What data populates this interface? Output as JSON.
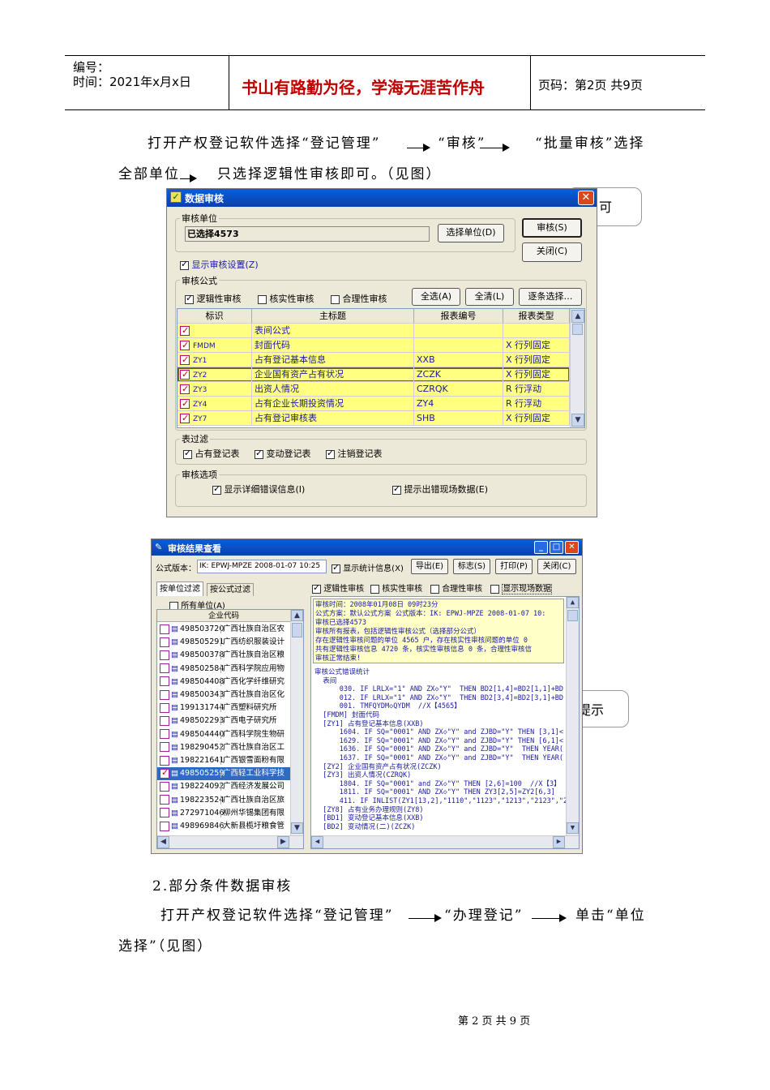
{
  "header": {
    "number_label": "编号：",
    "date_label": "时间：2021年x月x日",
    "motto": "书山有路勤为径，学海无涯苦作舟",
    "page_label": "页码：第2页  共9页"
  },
  "body": {
    "p1_a": "打开产权登记软件选择“登记管理”",
    "p1_b": "“审核”",
    "p1_c": "“批量审核”选择",
    "p1_d": "全部单位",
    "p1_e": "只选择逻辑性审核即可。（见图）",
    "callout1": "可",
    "callout2": "提示",
    "section2": "2.部分条件数据审核",
    "p2_a": "打开产权登记软件选择“登记管理”",
    "p2_b": "“办理登记”",
    "p2_c": "单击“单位",
    "p2_d": "选择”（见图）"
  },
  "dialog1": {
    "title": "数据审核",
    "unit_group": "审核单位",
    "unit_value": "已选择4573",
    "select_unit_btn": "选择单位(D)",
    "audit_btn": "审核(S)",
    "close_btn": "关闭(C)",
    "show_settings": "显示审核设置(Z)",
    "formula_group": "审核公式",
    "chk_logic": "逻辑性审核",
    "chk_real": "核实性审核",
    "chk_reason": "合理性审核",
    "btn_all": "全选(A)",
    "btn_clear": "全清(L)",
    "btn_each": "逐条选择…",
    "columns": [
      "标识",
      "主标题",
      "报表编号",
      "报表类型"
    ],
    "rows": [
      {
        "id": "",
        "title": "表间公式",
        "code": "",
        "type": ""
      },
      {
        "id": "FMDM",
        "title": "封面代码",
        "code": "",
        "type": "X 行列固定"
      },
      {
        "id": "ZY1",
        "title": "占有登记基本信息",
        "code": "XXB",
        "type": "X 行列固定"
      },
      {
        "id": "ZY2",
        "title": "企业国有资产占有状况",
        "code": "ZCZK",
        "type": "X 行列固定"
      },
      {
        "id": "ZY3",
        "title": "出资人情况",
        "code": "CZRQK",
        "type": "R 行浮动"
      },
      {
        "id": "ZY4",
        "title": "占有企业长期投资情况",
        "code": "ZY4",
        "type": "R 行浮动"
      },
      {
        "id": "ZY7",
        "title": "占有登记审核表",
        "code": "SHB",
        "type": "X 行列固定"
      }
    ],
    "filter_group": "表过滤",
    "filter_items": [
      "占有登记表",
      "变动登记表",
      "注销登记表"
    ],
    "option_group": "审核选项",
    "opt_detail": "显示详细错误信息(I)",
    "opt_site": "提示出错现场数据(E)"
  },
  "dialog2": {
    "title": "审核结果查看",
    "formula_version_label": "公式版本：",
    "formula_version_value": "IK: EPWJ-MPZE 2008-01-07 10:25",
    "show_stats": "显示统计信息(X)",
    "btn_export": "导出(E)",
    "btn_mark": "标志(S)",
    "btn_print": "打印(P)",
    "btn_close": "关闭(C)",
    "tab_unit": "按单位过滤",
    "tab_formula": "按公式过滤",
    "chk_logic": "逻辑性审核",
    "chk_real": "核实性审核",
    "chk_reason": "合理性审核",
    "chk_site": "显示现场数据",
    "all_units": "所有单位(A)",
    "col_code": "企业代码",
    "units": [
      {
        "code": "498503720",
        "name": "广西壮族自治区农"
      },
      {
        "code": "498505291",
        "name": "广西纺织服装设计"
      },
      {
        "code": "498500378",
        "name": "广西壮族自治区粮"
      },
      {
        "code": "498502584",
        "name": "广西科学院应用物"
      },
      {
        "code": "498504408",
        "name": "广西化学纤维研究"
      },
      {
        "code": "498500343",
        "name": "广西壮族自治区化"
      },
      {
        "code": "199131744",
        "name": "广西塑料研究所"
      },
      {
        "code": "498502293",
        "name": "广西电子研究所"
      },
      {
        "code": "498504440",
        "name": "广西科学院生物研"
      },
      {
        "code": "198290452",
        "name": "广西壮族自治区工"
      },
      {
        "code": "198221641",
        "name": "广西银雪面粉有限"
      },
      {
        "code": "498505259",
        "name": "广西轻工业科学技"
      },
      {
        "code": "198224092",
        "name": "广西经济发展公司"
      },
      {
        "code": "198223524",
        "name": "广西壮族自治区旅"
      },
      {
        "code": "272971046",
        "name": "柳州华锡集团有限"
      },
      {
        "code": "498969846",
        "name": "大新县榄圩粮食管"
      }
    ],
    "log_head": [
      "审核时间：2008年01月08日 09时23分",
      "公式方案：默认公式方案 公式版本：IK: EPWJ-MPZE 2008-01-07 10:",
      "审核已选择4573",
      "审核所有报表，包括逻辑性审核公式（选择部分公式）",
      "存在逻辑性审核问题的单位 4565 户，存在核实性审核问题的单位 0",
      "共有逻辑性审核信息 4720 条，核实性审核信息 0 条，合理性审核信",
      "审核正常结束!"
    ],
    "log_body": [
      "审核公式错误统计",
      "  表间",
      "      030. IF LRLX=\"1\" AND ZX◇\"Y\"  THEN BD2[1,4]=BD2[1,1]+BD",
      "      012. IF LRLX=\"1\" AND ZX◇\"Y\"  THEN BD2[3,4]=BD2[3,1]+BD",
      "      001. TMFQYDM◇QYDM  //X【4565】",
      "  [FMDM] 封面代码",
      "  [ZY1] 占有登记基本信息(XXB)",
      "      1604. IF SQ=\"0001\" AND ZX◇\"Y\" and ZJBD=\"Y\" THEN [3,1]<",
      "      1629. IF SQ=\"0001\" AND ZX◇\"Y\" and ZJBD=\"Y\" THEN [6,1]<",
      "      1636. IF SQ=\"0001\" AND ZX◇\"Y\" and ZJBD=\"Y\"  THEN YEAR(",
      "      1637. IF SQ=\"0001\" AND ZX◇\"Y\" and ZJBD=\"Y\"  THEN YEAR(",
      "  [ZY2] 企业国有资产占有状况(ZCZK)",
      "  [ZY3] 出资人情况(CZRQK)",
      "      1804. IF SQ=\"0001\" and ZX◇\"Y\" THEN [2,6]=100  //X【3】",
      "      1811. IF SQ=\"0001\" AND ZX◇\"Y\" THEN ZY3[2,5]=ZY2[6,3]",
      "      411. IF INLIST(ZY1[13,2],\"1110\",\"1123\",\"1213\",\"2123\",\"2:",
      "  [ZY8] 占有业务办理规则(ZY8)",
      "  [BD1] 变动登记基本信息(XXB)",
      "  [BD2] 变动情况(二)(ZCZK)"
    ]
  },
  "footer": {
    "page_text": "第 2 页 共 9 页"
  }
}
